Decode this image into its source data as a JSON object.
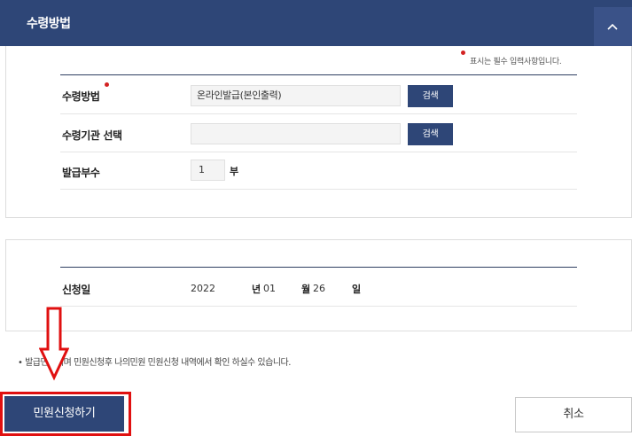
{
  "header": {
    "title": "수령방법",
    "toggle_icon": "chevron-up-icon"
  },
  "form": {
    "required_note": "표시는 필수 입력사항입니다.",
    "receive_method": {
      "label": "수령방법",
      "value": "온라인발급(본인출력)",
      "search_label": "검색"
    },
    "institution": {
      "label": "수령기관 선택",
      "value": "",
      "search_label": "검색"
    },
    "copies": {
      "label": "발급부수",
      "value": "1",
      "unit": "부"
    }
  },
  "application": {
    "label": "신청일",
    "year": "2022",
    "year_unit": "년",
    "month": "01",
    "month_unit": "월",
    "day": "26",
    "day_unit": "일"
  },
  "notice": "• 발급민원이며 민원신청후 나의민원 민원신청 내역에서 확인 하실수 있습니다.",
  "buttons": {
    "apply": "민원신청하기",
    "cancel": "취소"
  },
  "colors": {
    "brand": "#2e4677",
    "required": "#d32222",
    "annotation": "#e01010"
  }
}
